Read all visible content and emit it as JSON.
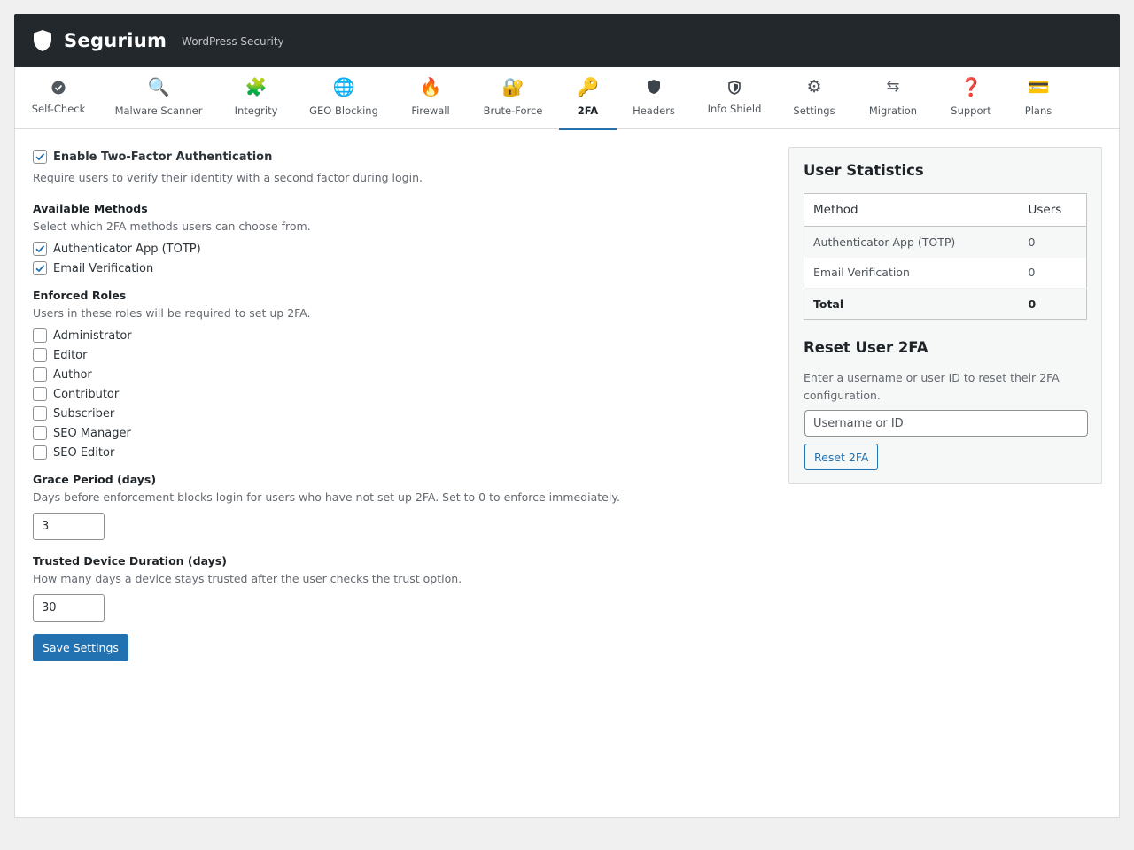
{
  "app": {
    "name": "Segurium",
    "tagline": "WordPress Security",
    "accent_color": "#2271b1",
    "header_color": "#23282d"
  },
  "tabs": [
    {
      "label": "Self-Check",
      "icon": "check-circle-icon"
    },
    {
      "label": "Malware Scanner",
      "icon": "magnifier-icon"
    },
    {
      "label": "Integrity",
      "icon": "puzzle-icon"
    },
    {
      "label": "GEO Blocking",
      "icon": "globe-icon"
    },
    {
      "label": "Firewall",
      "icon": "fire-icon"
    },
    {
      "label": "Brute-Force",
      "icon": "lock-key-icon"
    },
    {
      "label": "2FA",
      "icon": "key-icon",
      "active": true
    },
    {
      "label": "Headers",
      "icon": "shield-icon"
    },
    {
      "label": "Info Shield",
      "icon": "shield-info-icon"
    },
    {
      "label": "Settings",
      "icon": "gear-icon"
    },
    {
      "label": "Migration",
      "icon": "arrows-icon"
    },
    {
      "label": "Support",
      "icon": "question-icon"
    },
    {
      "label": "Plans",
      "icon": "credit-card-icon"
    }
  ],
  "enable_2fa": {
    "label": "Enable Two-Factor Authentication",
    "checked": true,
    "description": "Require users to verify their identity with a second factor during login."
  },
  "methods": {
    "title": "Available Methods",
    "description": "Select which 2FA methods users can choose from.",
    "items": [
      {
        "label": "Authenticator App (TOTP)",
        "checked": true
      },
      {
        "label": "Email Verification",
        "checked": true
      }
    ]
  },
  "roles": {
    "title": "Enforced Roles",
    "description": "Users in these roles will be required to set up 2FA.",
    "items": [
      {
        "label": "Administrator",
        "checked": false
      },
      {
        "label": "Editor",
        "checked": false
      },
      {
        "label": "Author",
        "checked": false
      },
      {
        "label": "Contributor",
        "checked": false
      },
      {
        "label": "Subscriber",
        "checked": false
      },
      {
        "label": "SEO Manager",
        "checked": false
      },
      {
        "label": "SEO Editor",
        "checked": false
      }
    ]
  },
  "grace": {
    "title": "Grace Period (days)",
    "description": "Days before enforcement blocks login for users who have not set up 2FA. Set to 0 to enforce immediately.",
    "value": "3"
  },
  "trusted": {
    "title": "Trusted Device Duration (days)",
    "description": "How many days a device stays trusted after the user checks the trust option.",
    "value": "30"
  },
  "save_label": "Save Settings",
  "stats": {
    "title": "User Statistics",
    "col_method": "Method",
    "col_users": "Users",
    "rows": [
      {
        "method": "Authenticator App (TOTP)",
        "users": "0"
      },
      {
        "method": "Email Verification",
        "users": "0"
      }
    ],
    "total_label": "Total",
    "total_value": "0"
  },
  "reset": {
    "title": "Reset User 2FA",
    "description": "Enter a username or user ID to reset their 2FA configuration.",
    "placeholder": "Username or ID",
    "button_label": "Reset 2FA"
  }
}
